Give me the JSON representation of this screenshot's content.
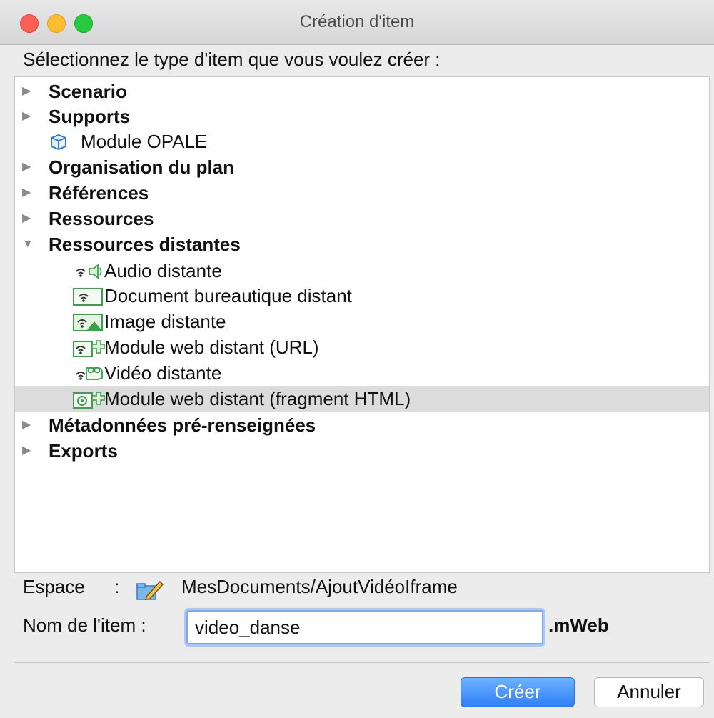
{
  "window": {
    "title": "Création d'item"
  },
  "prompt": "Sélectionnez le type d'item que vous voulez créer :",
  "tree": {
    "nodes": [
      {
        "label": "Scenario",
        "expanded": false
      },
      {
        "label": "Supports",
        "expanded": false
      },
      {
        "label": "Module OPALE",
        "icon": "cube-icon"
      },
      {
        "label": "Organisation du plan",
        "expanded": false
      },
      {
        "label": "Références",
        "expanded": false
      },
      {
        "label": "Ressources",
        "expanded": false
      },
      {
        "label": "Ressources distantes",
        "expanded": true
      },
      {
        "label": "Audio distante",
        "icon": "remote-audio-icon"
      },
      {
        "label": "Document bureautique distant",
        "icon": "remote-document-icon"
      },
      {
        "label": "Image distante",
        "icon": "remote-image-icon"
      },
      {
        "label": "Module web distant (URL)",
        "icon": "remote-web-module-icon"
      },
      {
        "label": "Vidéo distante",
        "icon": "remote-video-icon"
      },
      {
        "label": "Module web distant (fragment HTML)",
        "icon": "remote-html-fragment-icon",
        "selected": true
      },
      {
        "label": "Métadonnées pré-renseignées",
        "expanded": false
      },
      {
        "label": "Exports",
        "expanded": false
      }
    ]
  },
  "space": {
    "label": "Espace",
    "colon": ":",
    "icon": "edit-folder-icon",
    "path": "MesDocuments/AjoutVidéoIframe"
  },
  "item_name": {
    "label": "Nom de l'item :",
    "value": "video_danse",
    "extension": ".mWeb"
  },
  "buttons": {
    "create": "Créer",
    "cancel": "Annuler"
  },
  "colors": {
    "selection": "#dcdcdc",
    "primary_button": "#2f7ff5",
    "focus_ring": "#7aaaf0",
    "remote_icon_green": "#3aa04a"
  }
}
